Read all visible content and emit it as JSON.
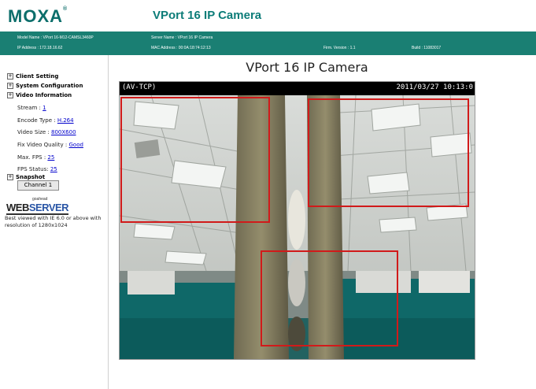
{
  "header": {
    "logo": "MOXA",
    "app_title": "VPort 16 IP Camera"
  },
  "info": {
    "model_name": "Model Name : VPort 16-M12-CAMSL3460P",
    "server_name": "Server Name : VPort 16 IP Camera",
    "ip_address": "IP Address : 172.18.16.62",
    "mac_address": "MAC Address : 00:0A:18:74:12:13",
    "firm_version": "Firm. Version : 1.1",
    "build": "Build : 11083017"
  },
  "sidebar": {
    "menu": [
      "Client Setting",
      "System Configuration",
      "Video Information"
    ],
    "video_info": [
      {
        "label": "Stream : ",
        "value": "1"
      },
      {
        "label": "Encode Type : ",
        "value": "H.264"
      },
      {
        "label": "Video Size : ",
        "value": "800X600"
      },
      {
        "label": "Fix Video Quality : ",
        "value": "Good"
      },
      {
        "label": "Max. FPS : ",
        "value": "25"
      },
      {
        "label": "FPS Status: ",
        "value": "25"
      }
    ],
    "snapshot": "Snapshot",
    "channel_button": "Channel 1",
    "webserver": {
      "small": "goahead",
      "web": "WEB",
      "server": "SERVER"
    },
    "best_viewed": "Best viewed with IE 6.0 or above with resolution of 1280x1024"
  },
  "video": {
    "title": "VPort 16 IP Camera",
    "overlay_left": "(AV-TCP)",
    "overlay_right": "2011/03/27 10:13:0"
  },
  "colors": {
    "brand": "#0c6e6b",
    "infobar": "#1a7f73",
    "motion_box": "#d11a1a"
  }
}
